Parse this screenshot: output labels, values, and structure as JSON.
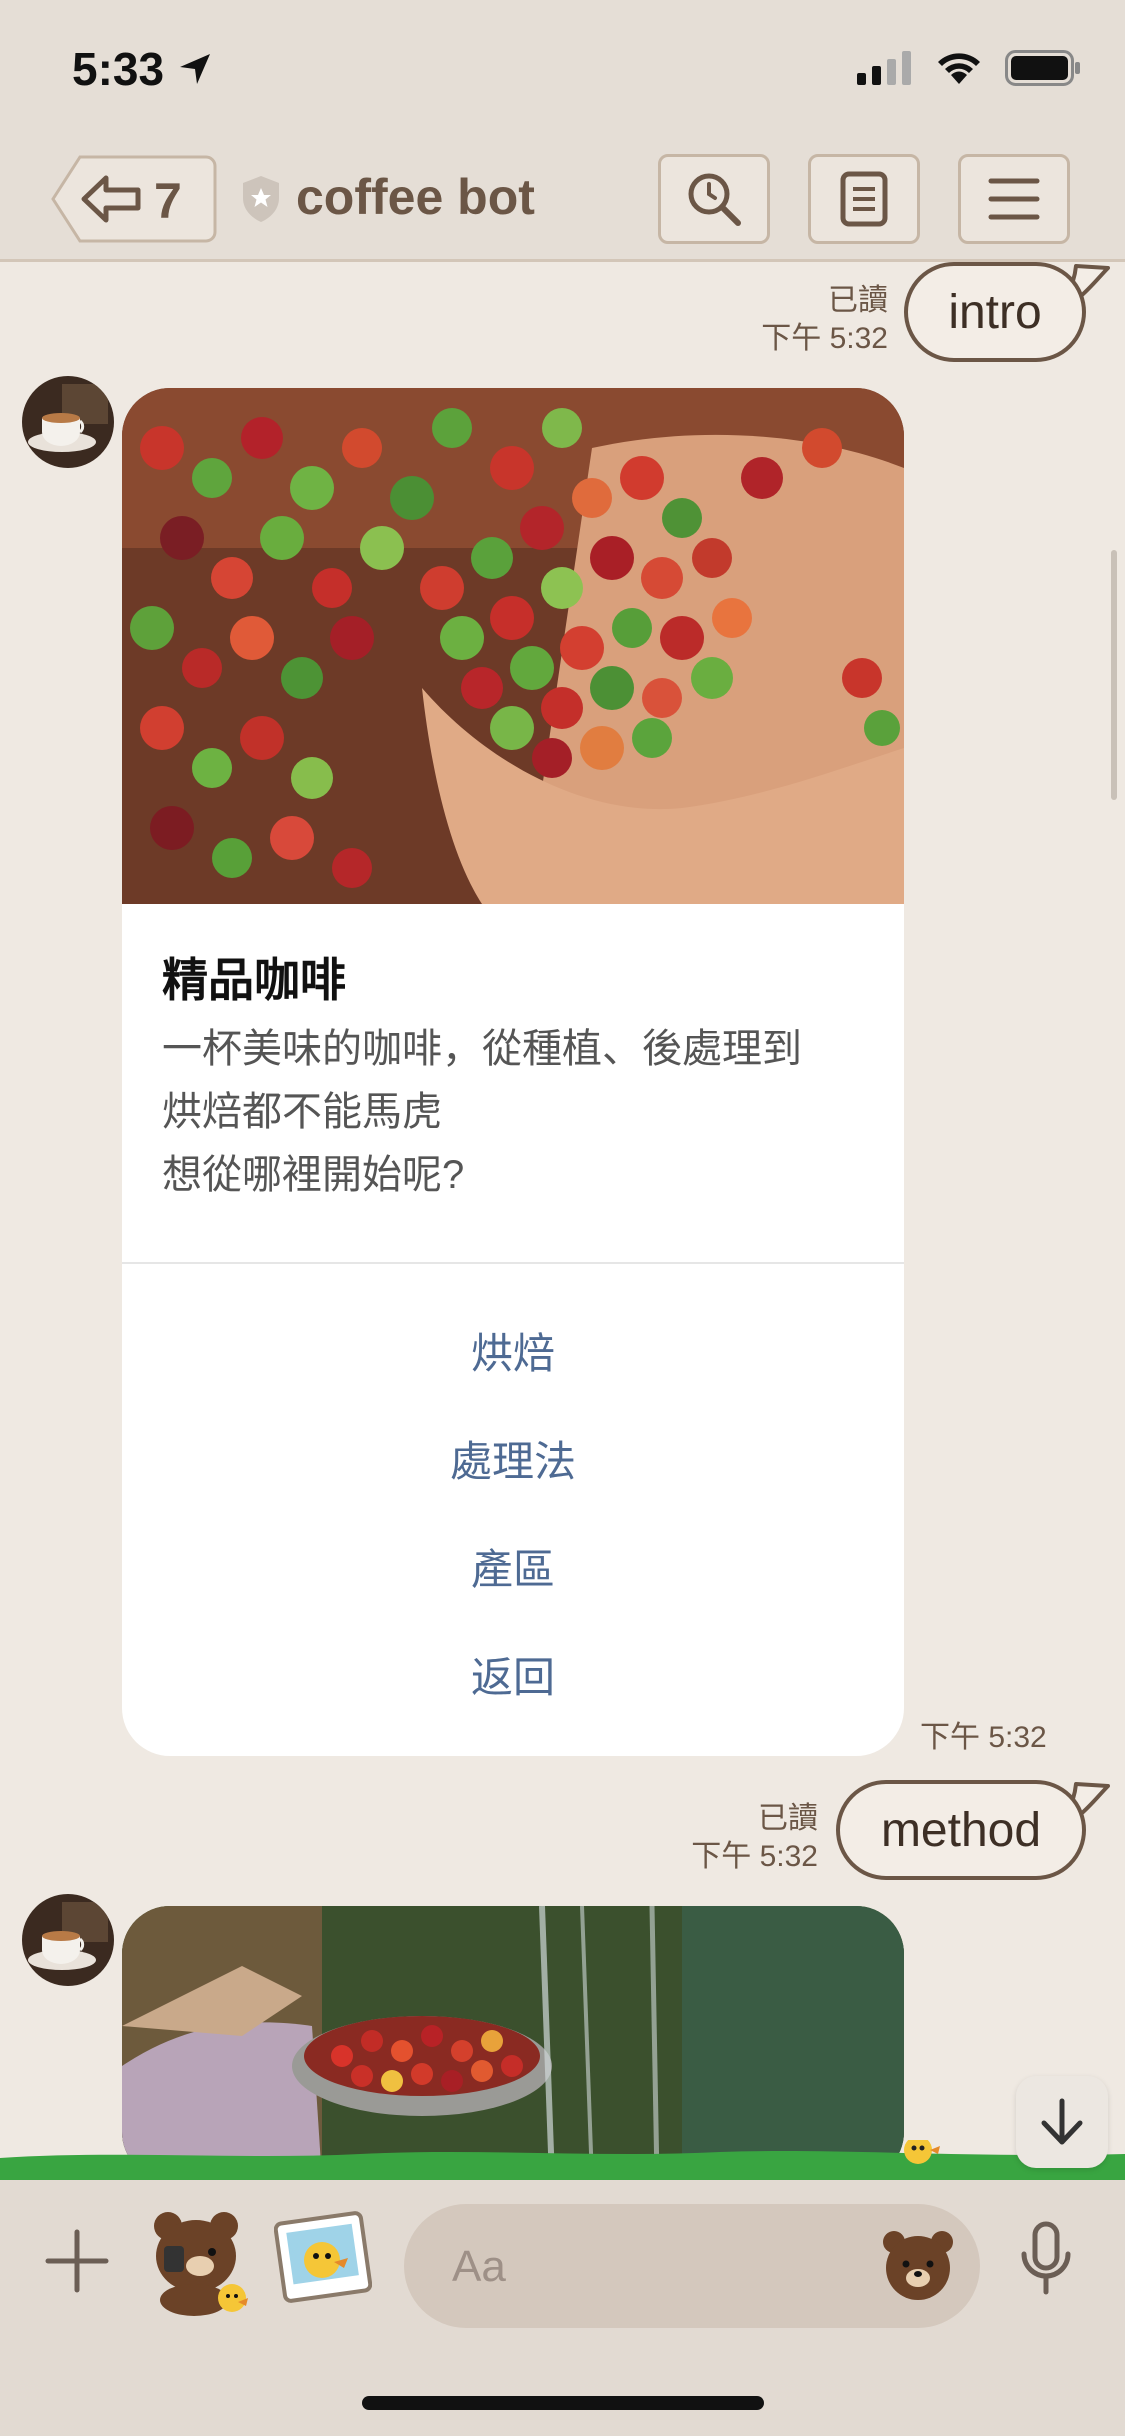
{
  "status_bar": {
    "time": "5:33"
  },
  "nav": {
    "back_count": "7",
    "title": "coffee bot",
    "icons": [
      "back-arrow-icon",
      "shield-icon",
      "search-icon",
      "notes-icon",
      "menu-icon"
    ]
  },
  "messages": {
    "intro": {
      "text": "intro",
      "read": "已讀",
      "time": "下午 5:32"
    },
    "card1": {
      "title": "精品咖啡",
      "desc_lines": [
        "一杯美味的咖啡，從種植、後處理到",
        "烘焙都不能馬虎",
        "想從哪裡開始呢?"
      ],
      "actions": [
        "烘焙",
        "處理法",
        "產區",
        "返回"
      ],
      "time": "下午 5:32"
    },
    "method": {
      "text": "method",
      "read": "已讀",
      "time": "下午 5:32"
    }
  },
  "input": {
    "placeholder": "Aa"
  },
  "colors": {
    "accent": "#6b5646",
    "link": "#4e6a93",
    "background": "#efe9e2",
    "bar": "#e5ded6"
  }
}
